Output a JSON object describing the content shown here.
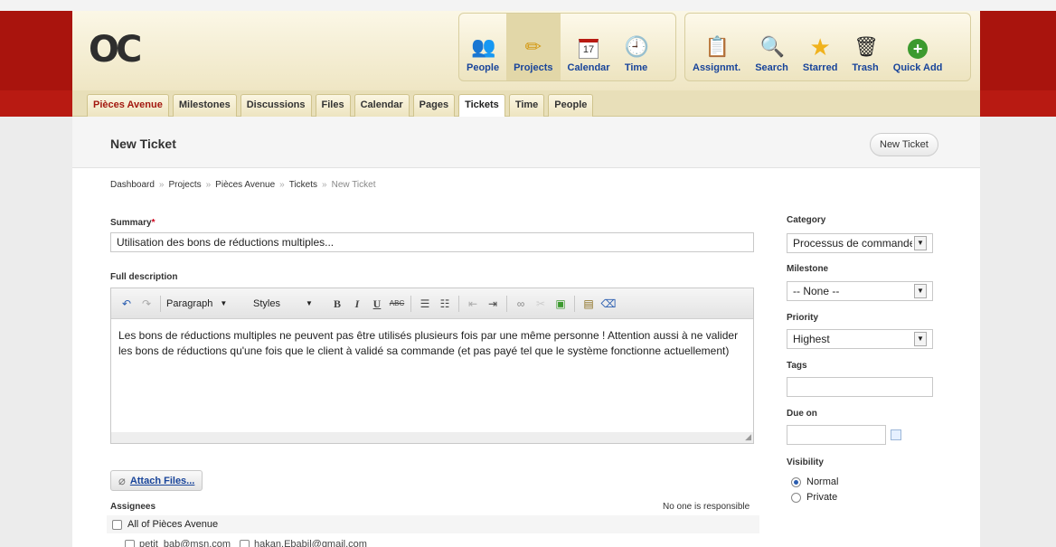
{
  "nav": {
    "group1": [
      {
        "label": "People",
        "icon": "people-icon",
        "glyph": "👥"
      },
      {
        "label": "Projects",
        "icon": "projects-icon",
        "glyph": "✏"
      },
      {
        "label": "Calendar",
        "icon": "calendar-icon",
        "glyph": "17"
      },
      {
        "label": "Time",
        "icon": "clock-icon",
        "glyph": "🕘"
      }
    ],
    "group2": [
      {
        "label": "Assignmt.",
        "icon": "clipboard-icon",
        "glyph": "📋"
      },
      {
        "label": "Search",
        "icon": "search-icon",
        "glyph": "🔍"
      },
      {
        "label": "Starred",
        "icon": "star-icon",
        "glyph": "★"
      },
      {
        "label": "Trash",
        "icon": "trash-icon",
        "glyph": "🗑"
      },
      {
        "label": "Quick Add",
        "icon": "plus-icon",
        "glyph": "+"
      }
    ]
  },
  "tabs": [
    "Pièces Avenue",
    "Milestones",
    "Discussions",
    "Files",
    "Calendar",
    "Pages",
    "Tickets",
    "Time",
    "People"
  ],
  "active_tab": "Tickets",
  "page": {
    "title": "New Ticket",
    "new_button": "New Ticket"
  },
  "breadcrumb": [
    "Dashboard",
    "Projects",
    "Pièces Avenue",
    "Tickets",
    "New Ticket"
  ],
  "breadcrumb_sep": "»",
  "form": {
    "summary_label": "Summary",
    "required_mark": "*",
    "summary_value": "Utilisation des bons de réductions multiples...",
    "description_label": "Full description",
    "description_text": "Les bons de réductions multiples ne peuvent pas être utilisés plusieurs fois par une même personne ! Attention aussi à ne valider les bons de réductions qu'une fois que le client à validé sa commande (et pas payé tel que le système fonctionne actuellement)",
    "attach_label": "Attach Files...",
    "assignees_label": "Assignees",
    "no_one": "No one is responsible",
    "all_of": "All of Pièces Avenue",
    "users": [
      "petit_bab@msn.com",
      "hakan.Ebabil@gmail.com"
    ]
  },
  "editor": {
    "format": "Paragraph",
    "styles": "Styles"
  },
  "sidebar": {
    "category_label": "Category",
    "category_value": "Processus de commande",
    "milestone_label": "Milestone",
    "milestone_value": "-- None --",
    "priority_label": "Priority",
    "priority_value": "Highest",
    "tags_label": "Tags",
    "due_label": "Due on",
    "visibility_label": "Visibility",
    "visibility_options": [
      "Normal",
      "Private"
    ],
    "visibility_selected": "Normal"
  },
  "colors": {
    "brand_red": "#b81a12",
    "link_blue": "#18449a",
    "header_cream": "#efe6c4"
  }
}
